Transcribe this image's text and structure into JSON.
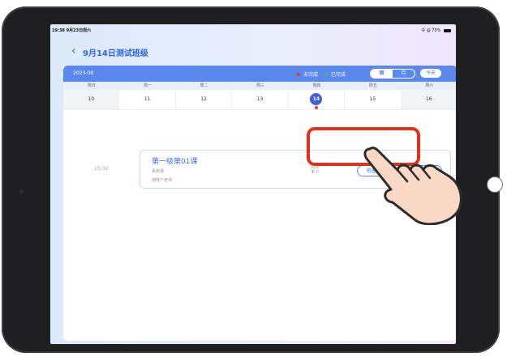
{
  "status_bar": {
    "time": "19:38  9月23日周六",
    "right": "令 @ 75%"
  },
  "header": {
    "back_glyph": "‹",
    "title": "9月14日测试班级"
  },
  "calendar": {
    "month": "2023-09",
    "legend": [
      {
        "label": "未完成",
        "color": "#e83c2f"
      },
      {
        "label": "已完成",
        "color": "#35c46a"
      }
    ],
    "view_toggle": [
      "周",
      "月"
    ],
    "active_view": "周",
    "today_button": "今天",
    "weekdays": [
      "周日",
      "周一",
      "周二",
      "周三",
      "周四",
      "周五",
      "周六"
    ],
    "dates": [
      "10",
      "11",
      "12",
      "13",
      "14",
      "15",
      "16"
    ],
    "selected_date": "14"
  },
  "lesson": {
    "time": "15:32",
    "title": "第一级第01课",
    "type": "系统课",
    "teacher": "德育户老师",
    "status": "完成率 0",
    "buttons": [
      "检查作业",
      "错题记录"
    ]
  },
  "colors": {
    "accent": "#5b88ee",
    "selected": "#3f5fd8",
    "highlight": "#e0331f"
  },
  "icons": [
    "back-chevron-icon",
    "wifi-icon",
    "battery-icon",
    "pointing-hand-icon"
  ]
}
